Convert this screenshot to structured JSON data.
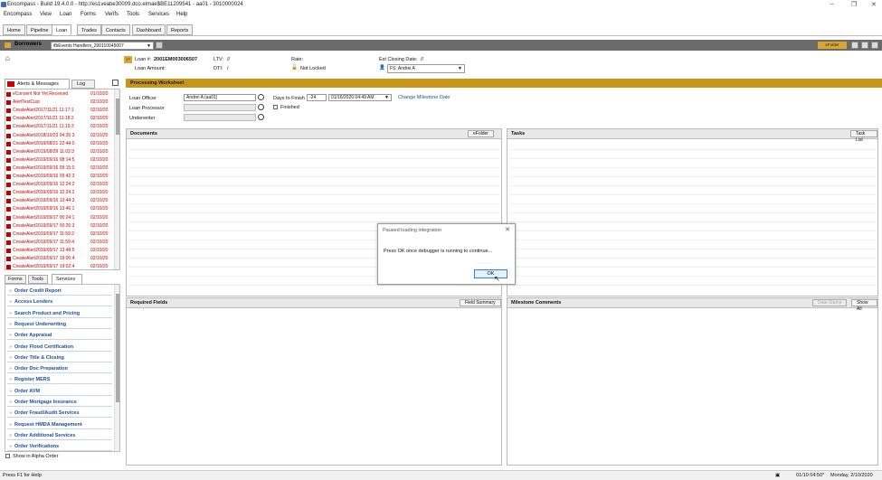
{
  "window": {
    "title": "Encompass - Build 19.4.0.0 - http://es1veabe30009.dco.elmae$BE11209541 - aa01 - 3010000024"
  },
  "menu": [
    "Encompass",
    "View",
    "Loan",
    "Forms",
    "Verifs",
    "Tools",
    "Services",
    "Help"
  ],
  "top_tabs": [
    "Home",
    "Pipeline",
    "Loan",
    "Trades",
    "Contacts",
    "Dashboard",
    "Reports"
  ],
  "borrowers": {
    "label": "Borrowers",
    "selected": "ifbEvents Handlers_200110045007",
    "efolder": "eFolder"
  },
  "header": {
    "loan_number_label": "Loan #:",
    "loan_number": "2001EM003006507",
    "loan_amount_label": "Loan Amount:",
    "ltv_label": "LTV:",
    "ltv_value": "//",
    "dti_label": "DTI:",
    "dti_value": "/",
    "rate_label": "Rate:",
    "lock_status": "Not Locked",
    "est_closing_label": "Est Closing Date:",
    "est_closing_value": "//",
    "fs_value": "FS: Andrei A"
  },
  "alerts": {
    "tabs": [
      "Alerts & Messages",
      "Log"
    ],
    "items": [
      {
        "name": "eConsent Not Yet Received",
        "date": "01/10/20"
      },
      {
        "name": "AlertTestCust",
        "date": "02/10/20"
      },
      {
        "name": "CreateAlert2017/11/21 11:17:1",
        "date": "02/10/20"
      },
      {
        "name": "CreateAlert2017/11/21 11:18:2",
        "date": "02/10/20"
      },
      {
        "name": "CreateAlert2017/11/21 11:19:3",
        "date": "02/10/20"
      },
      {
        "name": "CreateAlert2018/10/23 04:35:3",
        "date": "02/10/20"
      },
      {
        "name": "CreateAlert2019/08/21 22:44:0",
        "date": "02/10/20"
      },
      {
        "name": "CreateAlert2019/08/29 11:02:3",
        "date": "02/10/20"
      },
      {
        "name": "CreateAlert2019/09/16 08:14:5",
        "date": "02/10/20"
      },
      {
        "name": "CreateAlert2019/09/16 09:15:0",
        "date": "02/10/20"
      },
      {
        "name": "CreateAlert2019/09/16 09:42:3",
        "date": "02/10/20"
      },
      {
        "name": "CreateAlert2019/09/16 12:24:2",
        "date": "02/10/20"
      },
      {
        "name": "CreateAlert2019/09/16 12:24:2",
        "date": "02/10/20"
      },
      {
        "name": "CreateAlert2019/09/16 13:44:3",
        "date": "02/10/20"
      },
      {
        "name": "CreateAlert2019/09/16 13:46:1",
        "date": "02/10/20"
      },
      {
        "name": "CreateAlert2019/09/17 00:24:1",
        "date": "02/10/20"
      },
      {
        "name": "CreateAlert2019/09/17 00:26:3",
        "date": "02/10/20"
      },
      {
        "name": "CreateAlert2019/09/17 11:59:2",
        "date": "02/10/20"
      },
      {
        "name": "CreateAlert2019/09/17 11:59:4",
        "date": "02/10/20"
      },
      {
        "name": "CreateAlert2019/09/17 13:48:5",
        "date": "02/10/20"
      },
      {
        "name": "CreateAlert2019/09/17 19:00:4",
        "date": "02/10/20"
      },
      {
        "name": "CreateAlert2019/09/17 19:02:4",
        "date": "02/10/20"
      }
    ]
  },
  "services": {
    "tabs": [
      "Forms",
      "Tools",
      "Services"
    ],
    "items": [
      "Order Credit Report",
      "Access Lenders",
      "Search Product and Pricing",
      "Request Underwriting",
      "Order Appraisal",
      "Order Flood Certification",
      "Order Title & Closing",
      "Order Doc Preparation",
      "Register MERS",
      "Order AVM",
      "Order Mortgage Insurance",
      "Order Fraud/Audit Services",
      "Request HMDA Management",
      "Order Additional Services",
      "Order Verifications"
    ],
    "alpha_label": "Show in Alpha Order"
  },
  "worksheet": {
    "title": "Processing Worksheet",
    "loan_officer_label": "Loan Officer",
    "loan_officer_value": "Andrei A (aa01)",
    "loan_processor_label": "Loan Processor",
    "underwriter_label": "Underwriter",
    "days_to_finish_label": "Days to Finish",
    "days_to_finish_value": "-24",
    "date_value": "01/16/2020 04:49 AM",
    "change_milestone": "Change Milestone Date",
    "finished_label": "Finished"
  },
  "panels": {
    "documents": "Documents",
    "efolder_btn": "eFolder",
    "tasks": "Tasks",
    "task_list_btn": "Task List",
    "required_fields": "Required Fields",
    "field_summary_btn": "Field Summary",
    "milestone_comments": "Milestone Comments",
    "date_stamp_btn": "Date Stamp",
    "show_all_btn": "Show All"
  },
  "dialog": {
    "title": "Paused loading integration",
    "message": "Press OK once debugger is running to continue...",
    "ok": "OK"
  },
  "status": {
    "help": "Press F1 for Help",
    "time": "01/10 04:50*",
    "date": "Monday, 2/10/2020"
  }
}
